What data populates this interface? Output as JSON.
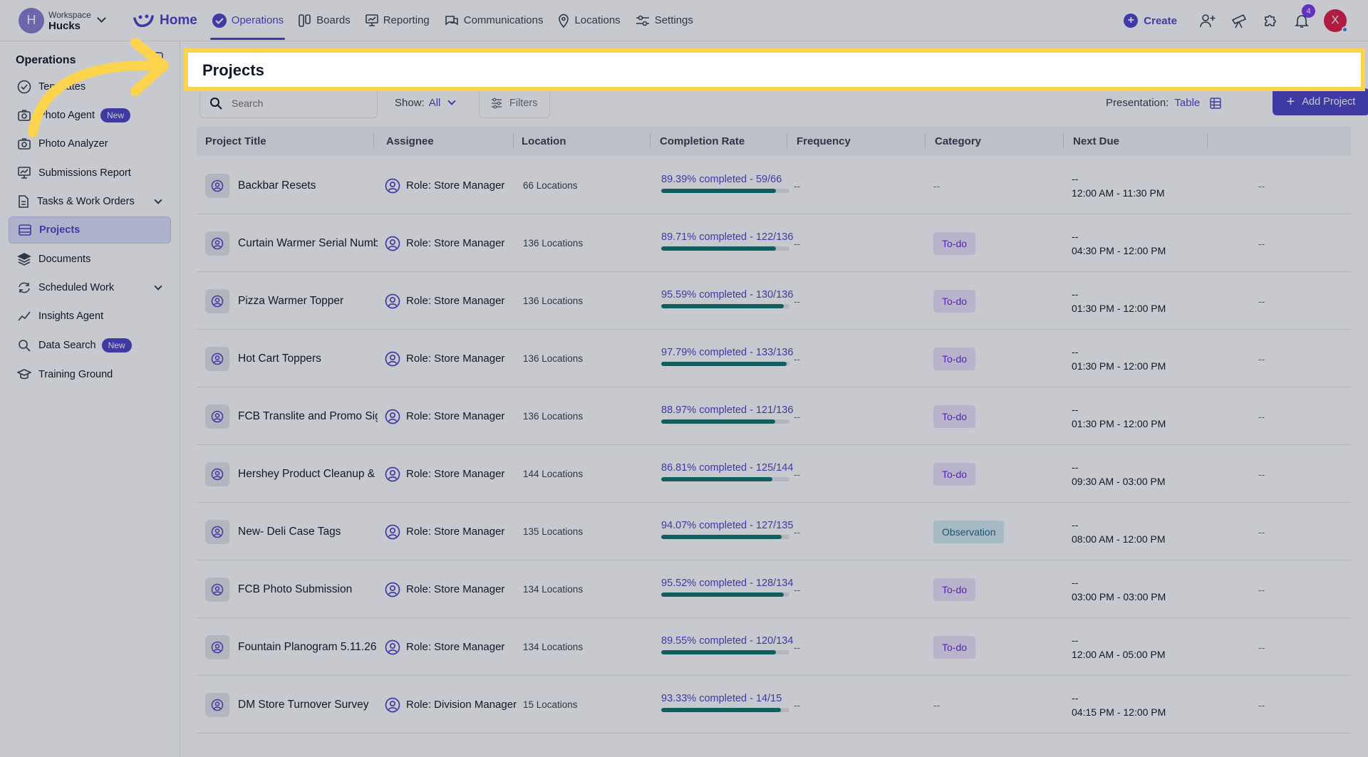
{
  "workspace": {
    "label": "Workspace",
    "name": "Hucks",
    "initial": "H"
  },
  "nav": {
    "home": "Home",
    "items": [
      {
        "label": "Operations",
        "icon": "check-circle-icon"
      },
      {
        "label": "Boards",
        "icon": "boards-icon"
      },
      {
        "label": "Reporting",
        "icon": "reporting-icon"
      },
      {
        "label": "Communications",
        "icon": "chat-icon"
      },
      {
        "label": "Locations",
        "icon": "location-pin-icon"
      },
      {
        "label": "Settings",
        "icon": "settings-icon"
      }
    ],
    "create": "Create",
    "notifications_count": "4",
    "user_initial": "X"
  },
  "sidebar": {
    "title": "Operations",
    "items": [
      {
        "label": "Templates",
        "icon": "check-circle-icon"
      },
      {
        "label": "Photo Agent",
        "icon": "camera-icon",
        "badge": "New"
      },
      {
        "label": "Photo Analyzer",
        "icon": "camera-icon"
      },
      {
        "label": "Submissions Report",
        "icon": "report-icon"
      },
      {
        "label": "Tasks & Work Orders",
        "icon": "document-icon"
      },
      {
        "label": "Projects",
        "icon": "projects-icon"
      },
      {
        "label": "Documents",
        "icon": "layers-icon"
      },
      {
        "label": "Scheduled Work",
        "icon": "refresh-icon"
      },
      {
        "label": "Insights Agent",
        "icon": "trend-icon"
      },
      {
        "label": "Data Search",
        "icon": "search-icon",
        "badge": "New"
      },
      {
        "label": "Training Ground",
        "icon": "graduation-cap-icon"
      }
    ]
  },
  "page": {
    "title": "Projects",
    "search_placeholder": "Search",
    "show_label": "Show:",
    "show_value": "All",
    "filters": "Filters",
    "presentation_label": "Presentation:",
    "presentation_value": "Table",
    "add_project": "Add Project"
  },
  "table": {
    "columns": [
      "Project Title",
      "Assignee",
      "Location",
      "Completion Rate",
      "Frequency",
      "Category",
      "Next Due"
    ],
    "rows": [
      {
        "title": "Backbar Resets",
        "assignee": "Role: Store Manager",
        "location": "66 Locations",
        "completion": "89.39% completed - 59/66",
        "pct": 89.39,
        "frequency": "--",
        "category": "--",
        "due_top": "--",
        "due_time": "12:00 AM - 11:30 PM",
        "extra": "--"
      },
      {
        "title": "Curtain Warmer Serial Numb",
        "assignee": "Role: Store Manager",
        "location": "136 Locations",
        "completion": "89.71% completed - 122/136",
        "pct": 89.71,
        "frequency": "--",
        "category": "To-do",
        "due_top": "--",
        "due_time": "04:30 PM - 12:00 PM",
        "extra": "--"
      },
      {
        "title": "Pizza Warmer Topper",
        "assignee": "Role: Store Manager",
        "location": "136 Locations",
        "completion": "95.59% completed - 130/136",
        "pct": 95.59,
        "frequency": "--",
        "category": "To-do",
        "due_top": "--",
        "due_time": "01:30 PM - 12:00 PM",
        "extra": "--"
      },
      {
        "title": "Hot Cart Toppers",
        "assignee": "Role: Store Manager",
        "location": "136 Locations",
        "completion": "97.79% completed - 133/136",
        "pct": 97.79,
        "frequency": "--",
        "category": "To-do",
        "due_top": "--",
        "due_time": "01:30 PM - 12:00 PM",
        "extra": "--"
      },
      {
        "title": "FCB Translite and Promo Sig",
        "assignee": "Role: Store Manager",
        "location": "136 Locations",
        "completion": "88.97% completed - 121/136",
        "pct": 88.97,
        "frequency": "--",
        "category": "To-do",
        "due_top": "--",
        "due_time": "01:30 PM - 12:00 PM",
        "extra": "--"
      },
      {
        "title": "Hershey Product Cleanup &",
        "assignee": "Role: Store Manager",
        "location": "144 Locations",
        "completion": "86.81% completed - 125/144",
        "pct": 86.81,
        "frequency": "--",
        "category": "To-do",
        "due_top": "--",
        "due_time": "09:30 AM - 03:00 PM",
        "extra": "--"
      },
      {
        "title": "New- Deli Case Tags",
        "assignee": "Role: Store Manager",
        "location": "135 Locations",
        "completion": "94.07% completed - 127/135",
        "pct": 94.07,
        "frequency": "--",
        "category": "Observation",
        "due_top": "--",
        "due_time": "08:00 AM - 12:00 PM",
        "extra": "--"
      },
      {
        "title": "FCB Photo Submission",
        "assignee": "Role: Store Manager",
        "location": "134 Locations",
        "completion": "95.52% completed - 128/134",
        "pct": 95.52,
        "frequency": "--",
        "category": "To-do",
        "due_top": "--",
        "due_time": "03:00 PM - 03:00 PM",
        "extra": "--"
      },
      {
        "title": "Fountain Planogram 5.11.26",
        "assignee": "Role: Store Manager",
        "location": "134 Locations",
        "completion": "89.55% completed - 120/134",
        "pct": 89.55,
        "frequency": "--",
        "category": "To-do",
        "due_top": "--",
        "due_time": "12:00 AM - 05:00 PM",
        "extra": "--"
      },
      {
        "title": "DM Store Turnover Survey",
        "assignee": "Role: Division Manager",
        "location": "15 Locations",
        "completion": "93.33% completed - 14/15",
        "pct": 93.33,
        "frequency": "--",
        "category": "--",
        "due_top": "--",
        "due_time": "04:15 PM - 12:00 PM",
        "extra": "--"
      }
    ]
  },
  "colors": {
    "accent": "#4f46c8",
    "progress": "#0f766e",
    "highlight": "#fcd34d"
  }
}
